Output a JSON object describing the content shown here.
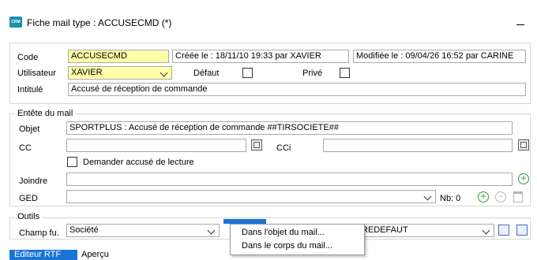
{
  "window": {
    "title": "Fiche mail type : ACCUSECMD (*)",
    "app_icon_text": "CRM"
  },
  "general": {
    "code_label": "Code",
    "code_value": "ACCUSECMD",
    "created_text": "Créée le : 18/11/10 19:33 par XAVIER",
    "modified_text": "Modifiée le : 09/04/26 16:52 par CARINE",
    "user_label": "Utilisateur",
    "user_value": "XAVIER",
    "default_label": "Défaut",
    "private_label": "Privé",
    "title_label": "Intitulé",
    "title_value": "Accusé de réception de commande"
  },
  "mail_header": {
    "group_title": "Entête du mail",
    "subject_label": "Objet",
    "subject_value": "SPORTPLUS : Accusé de réception de commande  ##TIRSOCIETE##",
    "cc_label": "CC",
    "cc_value": "",
    "cci_label": "CCi",
    "cci_value": "",
    "read_receipt_label": "Demander accusé de lecture",
    "attach_label": "Joindre",
    "attach_value": "",
    "ged_label": "GED",
    "ged_value": "",
    "nb_label": "Nb: 0"
  },
  "tools": {
    "group_title": "Outils",
    "function_field_label": "Champ fu.",
    "function_field_value": "Société",
    "variable_value": "REDEFAUT"
  },
  "context_menu": {
    "items": [
      "Dans l'objet du mail...",
      "Dans le corps du mail..."
    ]
  },
  "tabs": {
    "active": "Editeur RTF",
    "preview": "Aperçu"
  }
}
